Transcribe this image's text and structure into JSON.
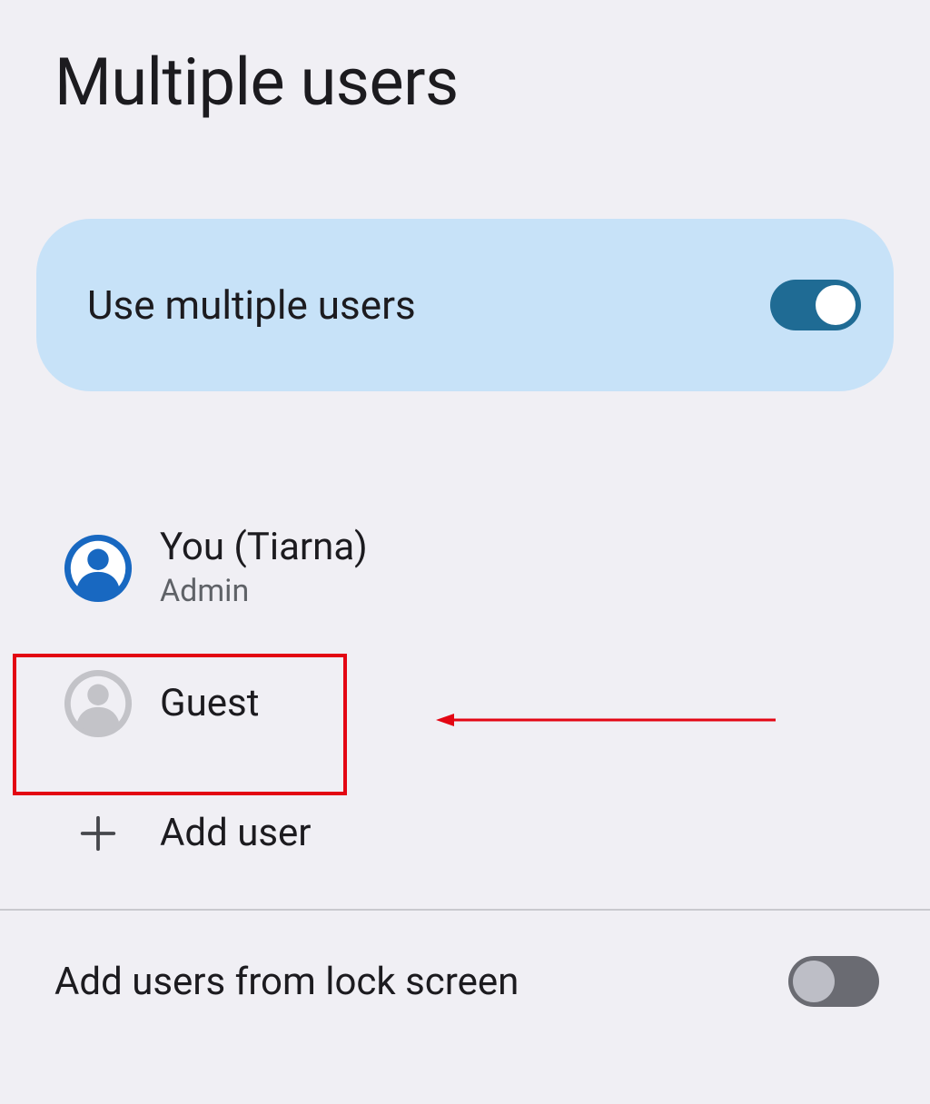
{
  "page": {
    "title": "Multiple users"
  },
  "toggle_card": {
    "label": "Use multiple users",
    "state": "on"
  },
  "users": [
    {
      "name": "You (Tiarna)",
      "subtitle": "Admin"
    },
    {
      "name": "Guest",
      "subtitle": ""
    }
  ],
  "add_user": {
    "label": "Add user"
  },
  "bottom_setting": {
    "label": "Add users from lock screen",
    "state": "off"
  },
  "annotations": {
    "highlight_target": "guest-user-row",
    "arrow_color": "#e30613"
  }
}
